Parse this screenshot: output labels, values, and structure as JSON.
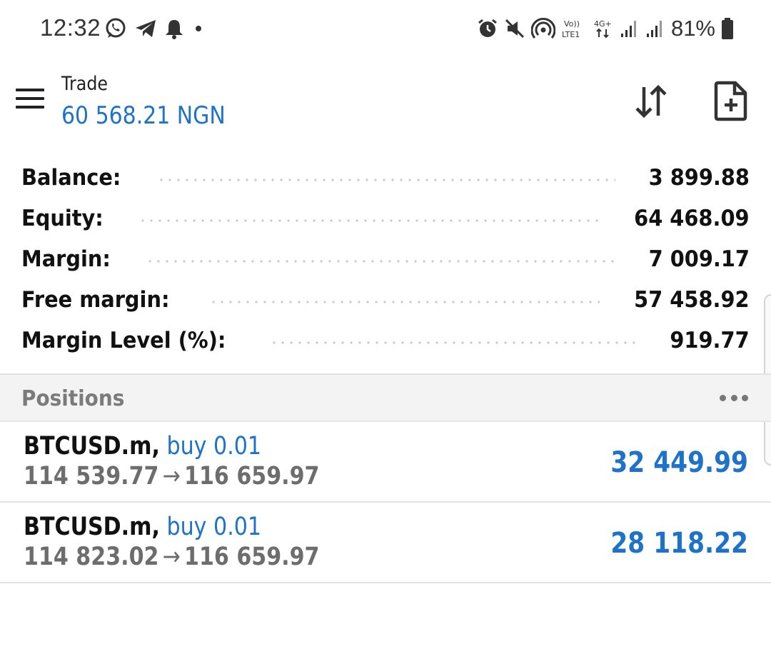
{
  "status_bar": {
    "time": "12:32",
    "battery": "81%",
    "left_icons": [
      "whatsapp-icon",
      "telegram-icon",
      "bell-icon",
      "dot-icon"
    ],
    "right_icons": [
      "alarm-icon",
      "mute-icon",
      "hotspot-icon",
      "volte-icon",
      "4g-icon",
      "signal-icon",
      "signal-icon",
      "battery-icon"
    ],
    "volte_label": "Vo)) LTE1",
    "network_label": "4G+"
  },
  "app_bar": {
    "title": "Trade",
    "balance_display": "60 568.21 NGN",
    "menu_icon": "hamburger-menu-icon",
    "sort_icon": "sort-arrows-icon",
    "new_order_icon": "new-document-icon"
  },
  "summary": [
    {
      "label": "Balance:",
      "value": "3 899.88"
    },
    {
      "label": "Equity:",
      "value": "64 468.09"
    },
    {
      "label": "Margin:",
      "value": "7 009.17"
    },
    {
      "label": "Free margin:",
      "value": "57 458.92"
    },
    {
      "label": "Margin Level (%):",
      "value": "919.77"
    }
  ],
  "positions": {
    "title": "Positions",
    "more_icon": "more-dots-icon",
    "items": [
      {
        "symbol": "BTCUSD.m,",
        "side": "buy 0.01",
        "open_price": "114 539.77",
        "arrow": "→",
        "current_price": "116 659.97",
        "profit": "32 449.99"
      },
      {
        "symbol": "BTCUSD.m,",
        "side": "buy 0.01",
        "open_price": "114 823.02",
        "arrow": "→",
        "current_price": "116 659.97",
        "profit": "28 118.22"
      }
    ]
  },
  "colors": {
    "accent_blue": "#1e73c8",
    "text_dark": "#111111",
    "text_grey": "#6d6d6d",
    "section_bg": "#f3f3f3"
  }
}
